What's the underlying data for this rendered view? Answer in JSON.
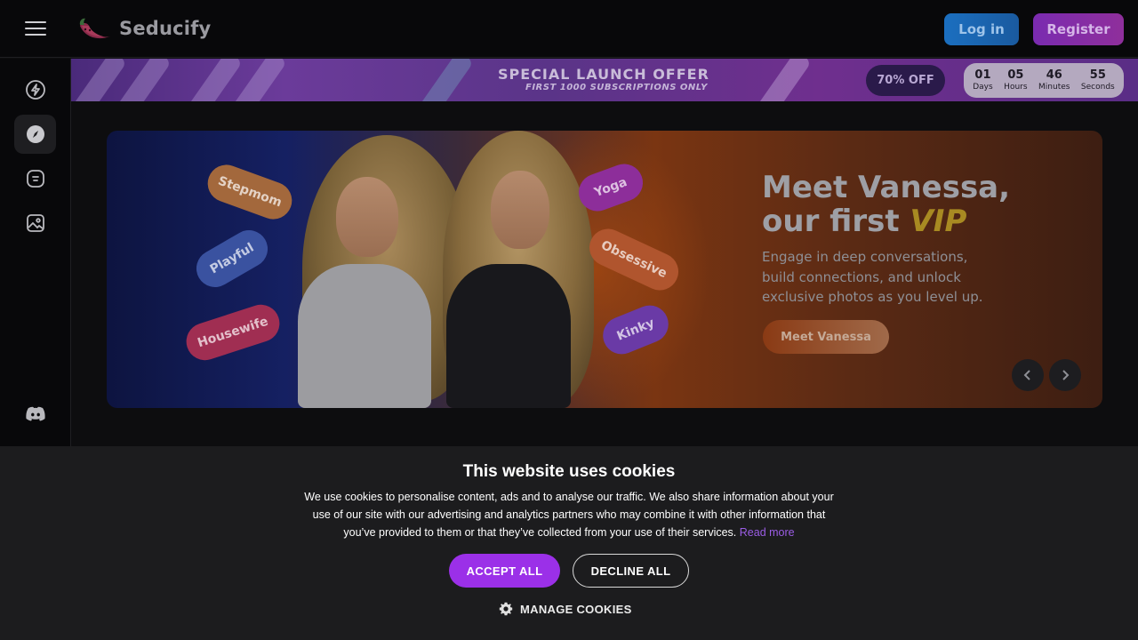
{
  "brand": {
    "name": "Seducify"
  },
  "header": {
    "login_label": "Log in",
    "register_label": "Register"
  },
  "sidebar": {
    "items": [
      {
        "icon": "bolt-icon"
      },
      {
        "icon": "compass-icon",
        "active": true
      },
      {
        "icon": "chat-icon"
      },
      {
        "icon": "gallery-icon"
      },
      {
        "icon": "discord-icon"
      }
    ]
  },
  "promo": {
    "title": "SPECIAL LAUNCH OFFER",
    "subtitle": "FIRST 1000 SUBSCRIPTIONS ONLY",
    "discount": "70% OFF",
    "countdown": [
      {
        "value": "01",
        "label": "Days"
      },
      {
        "value": "05",
        "label": "Hours"
      },
      {
        "value": "46",
        "label": "Minutes"
      },
      {
        "value": "55",
        "label": "Seconds"
      }
    ]
  },
  "hero": {
    "title_line1": "Meet Vanessa,",
    "title_line2": "our first",
    "title_highlight": "VIP",
    "description": "Engage in deep conversations, build connections, and unlock exclusive photos as you level up.",
    "cta_label": "Meet Vanessa",
    "tags": [
      "Stepmom",
      "Playful",
      "Housewife",
      "Yoga",
      "Obsessive",
      "Kinky"
    ]
  },
  "cookie": {
    "title": "This website uses cookies",
    "body": "We use cookies to personalise content, ads and to analyse our traffic. We also share information about your use of our site with our advertising and analytics partners who may combine it with other information that you’ve provided to them or that they’ve collected from your use of their services.",
    "read_more": "Read more",
    "accept_label": "ACCEPT ALL",
    "decline_label": "DECLINE ALL",
    "manage_label": "MANAGE COOKIES"
  },
  "colors": {
    "accent_purple": "#9b30e8",
    "login_blue": "#1b6fc0",
    "register_purple": "#7a2bb0"
  }
}
